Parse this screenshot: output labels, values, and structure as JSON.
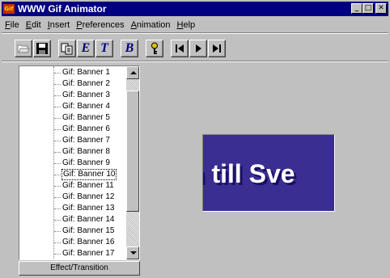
{
  "window": {
    "title": "WWW Gif Animator",
    "icon_text": "Gif"
  },
  "title_buttons": {
    "minimize": "_",
    "maximize": "□",
    "close": "✕"
  },
  "menu": [
    {
      "ul": "F",
      "rest": "ile"
    },
    {
      "ul": "E",
      "rest": "dit"
    },
    {
      "ul": "I",
      "rest": "nsert"
    },
    {
      "ul": "P",
      "rest": "references"
    },
    {
      "ul": "A",
      "rest": "nimation"
    },
    {
      "ul": "H",
      "rest": "elp"
    }
  ],
  "toolbar": {
    "edit_letter": "E",
    "text_letter": "T",
    "banner_letter": "B",
    "key_glyph": "🔑",
    "first_glyph": "|◀",
    "play_glyph": "▶",
    "last_glyph": "▶|"
  },
  "tree": {
    "items": [
      "Gif: Banner 1",
      "Gif: Banner 2",
      "Gif: Banner 3",
      "Gif: Banner 4",
      "Gif: Banner 5",
      "Gif: Banner 6",
      "Gif: Banner 7",
      "Gif: Banner 8",
      "Gif: Banner 9",
      "Gif: Banner 10",
      "Gif: Banner 11",
      "Gif: Banner 12",
      "Gif: Banner 13",
      "Gif: Banner 14",
      "Gif: Banner 15",
      "Gif: Banner 16",
      "Gif: Banner 17"
    ],
    "selected": "Gif: Banner 10"
  },
  "effect_button": "Effect/Transition",
  "preview": {
    "text": "n till Sve"
  }
}
